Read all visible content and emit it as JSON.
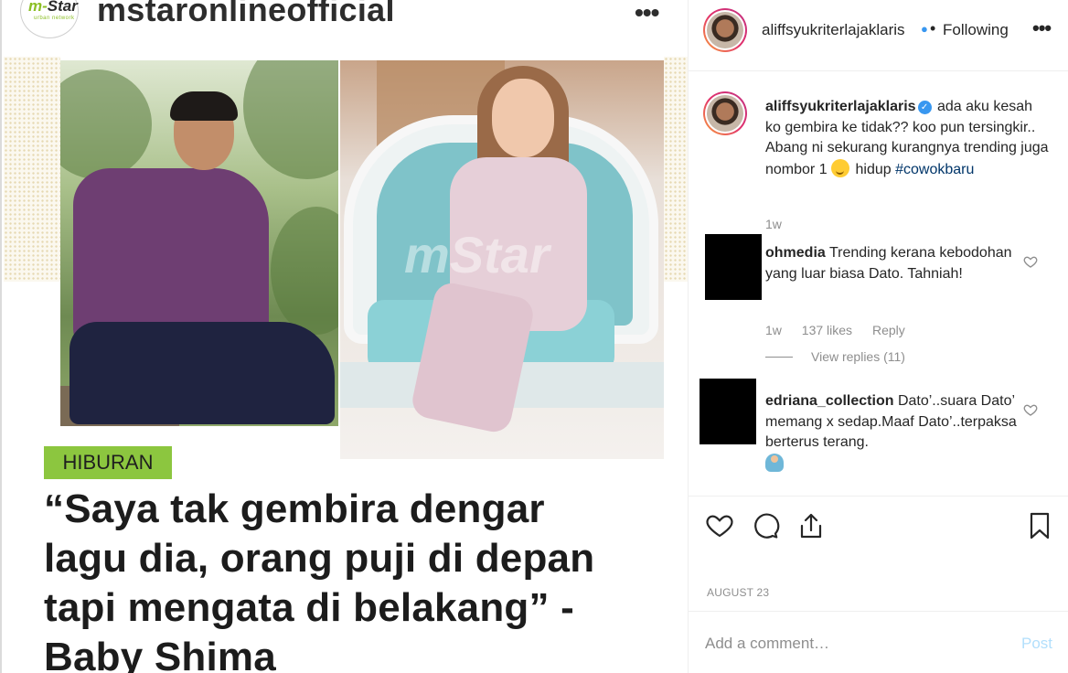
{
  "post_image": {
    "account_name": "mstaronlineofficial",
    "logo_text_m": "m-",
    "logo_text_star": "Star",
    "logo_subtext": "urban network",
    "more_glyph": "•••",
    "watermark": "mStar",
    "category_tag": "HIBURAN",
    "headline": "“Saya tak gembira dengar lagu dia, orang puji di depan tapi mengata di belakang” - Baby Shima"
  },
  "header": {
    "username": "aliffsyukriterlajaklaris",
    "separator": "•",
    "follow_status": "Following",
    "more_glyph": "•••"
  },
  "caption": {
    "username": "aliffsyukriterlajaklaris",
    "text_before_emoji": "ada aku kesah ko gembira ke tidak?? koo pun tersingkir.. Abang ni sekurang kurangnya trending juga nombor 1",
    "text_after_emoji": "hidup",
    "hashtag": "#cowokbaru",
    "time": "1w"
  },
  "comments": [
    {
      "username": "ohmedia",
      "text": "Trending kerana kebodohan yang luar biasa Dato. Tahniah!",
      "time": "1w",
      "likes": "137 likes",
      "reply_label": "Reply",
      "view_replies": "View replies (11)"
    },
    {
      "username": "edriana_collection",
      "text": "Dato’..suara Dato’ memang x sedap.Maaf Dato’..terpaksa berterus terang."
    }
  ],
  "actions": {
    "icons": [
      "heart-icon",
      "comment-icon",
      "share-icon",
      "bookmark-icon"
    ]
  },
  "post_date": "AUGUST 23",
  "comment_box": {
    "placeholder": "Add a comment…",
    "post_label": "Post"
  },
  "colors": {
    "link_blue": "#3897f0",
    "hashtag": "#003569",
    "muted_text": "#8e8e8e",
    "post_button_disabled": "#b2dffc",
    "tag_green": "#8cc63f"
  }
}
